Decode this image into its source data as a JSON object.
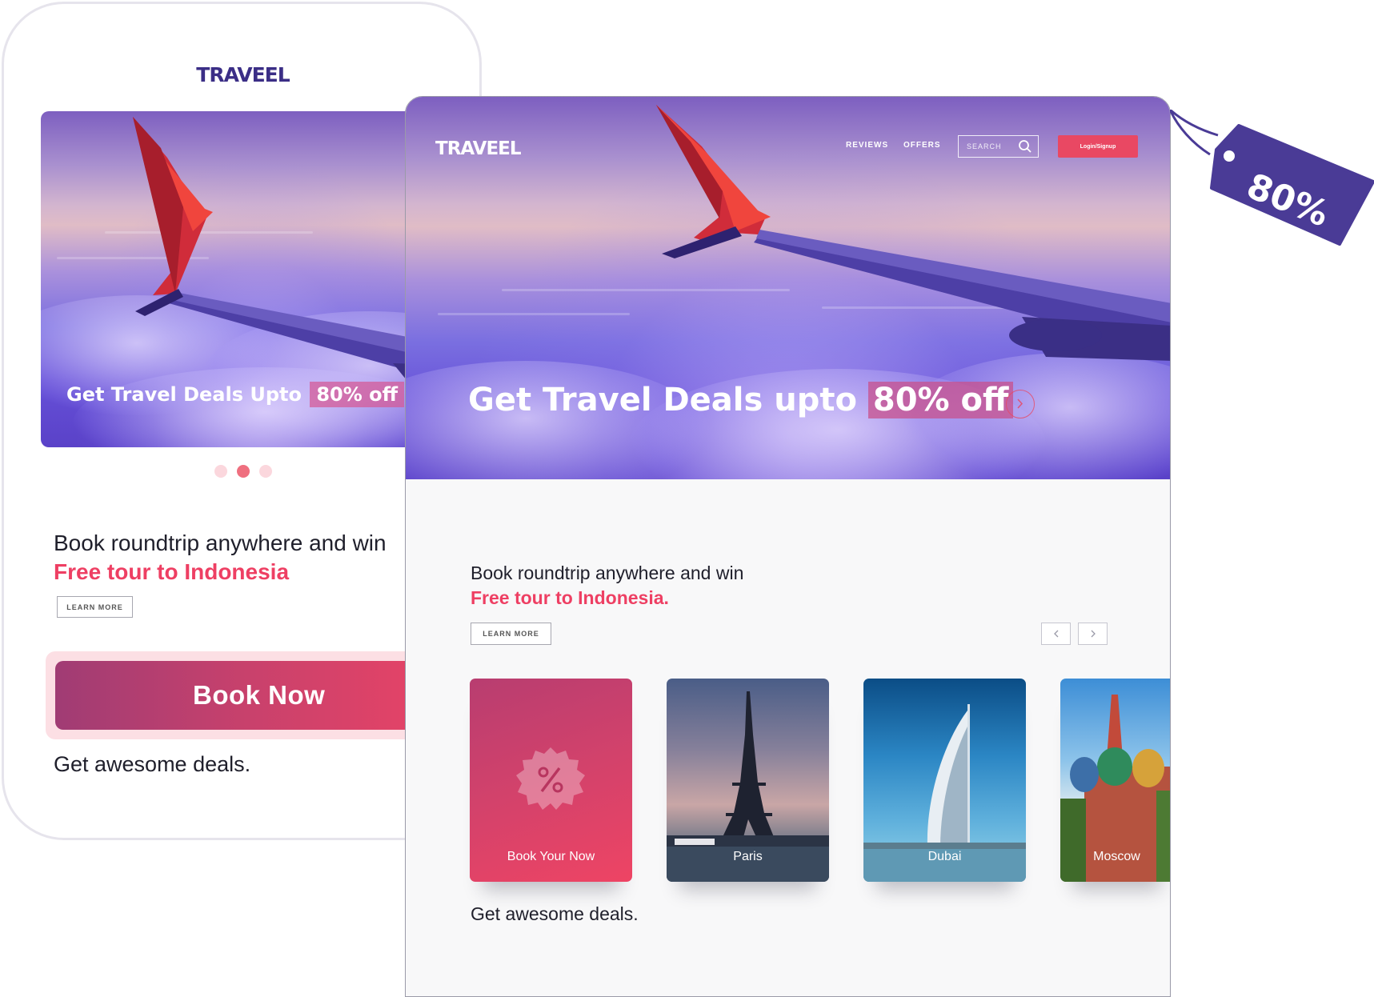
{
  "brand": {
    "name": "TRAVEEL",
    "logo_color_mobile": "#3b2e86",
    "accent_pink": "#ee3f63",
    "tag_color": "#4a3b96"
  },
  "mobile": {
    "hero": {
      "title_prefix": "Get Travel Deals Upto",
      "title_highlight": "80% off"
    },
    "carousel": {
      "dots": 3,
      "active_index": 1
    },
    "promo": {
      "line1": "Book roundtrip anywhere and win",
      "line2": "Free tour to Indonesia"
    },
    "learn_more_label": "LEARN MORE",
    "book_now_label": "Book Now",
    "deals_text": "Get awesome deals."
  },
  "desktop": {
    "nav": {
      "reviews": "REVIEWS",
      "offers": "OFFERS",
      "search_placeholder": "SEARCH",
      "login_label": "Login/Signup"
    },
    "hero": {
      "title_prefix": "Get Travel Deals upto",
      "title_highlight": "80% off"
    },
    "promo": {
      "line1": "Book roundtrip anywhere and win",
      "line2": "Free tour to Indonesia."
    },
    "learn_more_label": "LEARN MORE",
    "cards": [
      {
        "label": "Book Your Now",
        "icon": "percent-badge-icon"
      },
      {
        "label": "Paris",
        "icon": "eiffel-tower-illustration"
      },
      {
        "label": "Dubai",
        "icon": "burj-al-arab-illustration"
      },
      {
        "label": "Moscow",
        "icon": "st-basils-cathedral-illustration"
      }
    ],
    "deals_text": "Get awesome deals."
  },
  "price_tag": {
    "text": "80%"
  }
}
